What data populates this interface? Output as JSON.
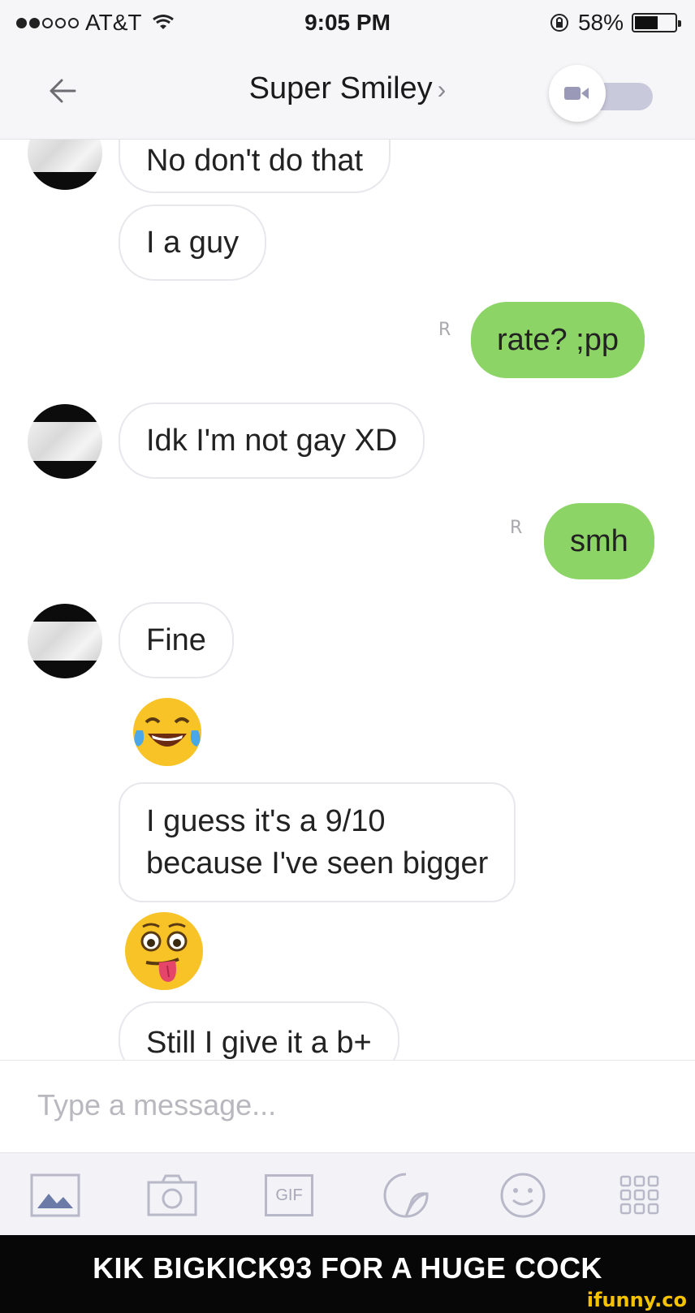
{
  "status_bar": {
    "carrier": "AT&T",
    "time": "9:05 PM",
    "battery": "58%",
    "battery_level": 0.58
  },
  "header": {
    "title": "Super Smiley",
    "chevron": "›",
    "back_icon": "arrow-left-icon",
    "video_toggle_icon": "video-camera-icon"
  },
  "messages": [
    {
      "direction": "incoming",
      "text": "No don't do that"
    },
    {
      "direction": "incoming",
      "text": "I a guy"
    },
    {
      "direction": "outgoing",
      "text": "rate? ;pp",
      "read_receipt": "R"
    },
    {
      "direction": "incoming",
      "text": "Idk I'm not gay XD"
    },
    {
      "direction": "outgoing",
      "text": "smh",
      "read_receipt": "R"
    },
    {
      "direction": "incoming",
      "text": "Fine"
    },
    {
      "direction": "incoming",
      "emoji": "face-with-tears-of-joy"
    },
    {
      "direction": "incoming",
      "text_lines": [
        "I guess it's a 9/10",
        "because I've seen bigger"
      ]
    },
    {
      "direction": "incoming",
      "emoji": "zany-face-tongue-out"
    },
    {
      "direction": "incoming",
      "text": "Still I give it a b+"
    }
  ],
  "composer": {
    "placeholder": "Type a message..."
  },
  "toolbar": {
    "items": [
      "gallery-icon",
      "camera-icon",
      "gif-icon",
      "sticker-icon",
      "smiley-icon",
      "grid-apps-icon"
    ],
    "gif_label": "GIF"
  },
  "caption": {
    "text": "KIK BIGKICK93 FOR A HUGE COCK",
    "watermark": "ifunny.co"
  },
  "colors": {
    "outgoing_bubble": "#8cd465",
    "incoming_border": "#e7e7ec",
    "caption_bg": "#070707",
    "watermark": "#f5c200"
  }
}
